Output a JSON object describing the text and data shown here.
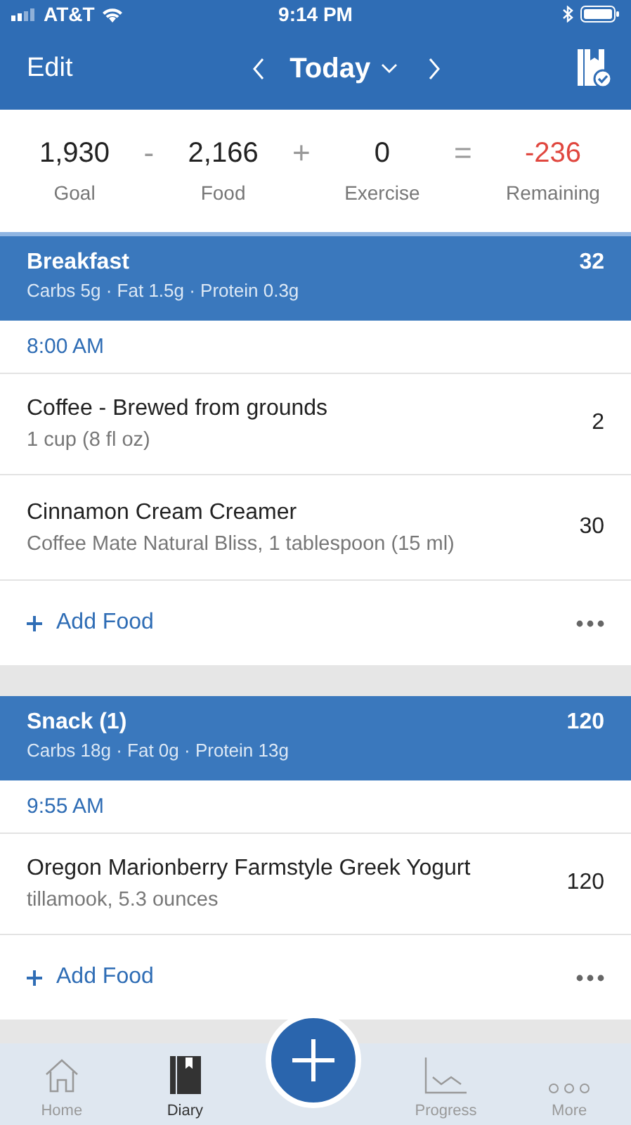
{
  "status_bar": {
    "carrier": "AT&T",
    "time": "9:14 PM"
  },
  "nav": {
    "edit": "Edit",
    "title": "Today"
  },
  "summary": {
    "operators": [
      "-",
      "+",
      "="
    ],
    "terms": [
      {
        "value": "1,930",
        "label": "Goal",
        "negative": false
      },
      {
        "value": "2,166",
        "label": "Food",
        "negative": false
      },
      {
        "value": "0",
        "label": "Exercise",
        "negative": false
      },
      {
        "value": "-236",
        "label": "Remaining",
        "negative": true
      }
    ]
  },
  "meals": [
    {
      "name": "Breakfast",
      "calories": "32",
      "macros": "Carbs 5g · Fat 1.5g · Protein 0.3g",
      "time": "8:00 AM",
      "add_label": "Add Food",
      "foods": [
        {
          "name": "Coffee - Brewed from grounds",
          "detail": "1 cup (8 fl oz)",
          "calories": "2"
        },
        {
          "name": "Cinnamon Cream Creamer",
          "detail": "Coffee Mate Natural Bliss, 1 tablespoon (15 ml)",
          "calories": "30"
        }
      ]
    },
    {
      "name": "Snack (1)",
      "calories": "120",
      "macros": "Carbs 18g · Fat 0g · Protein 13g",
      "time": "9:55 AM",
      "add_label": "Add Food",
      "foods": [
        {
          "name": "Oregon Marionberry Farmstyle Greek Yogurt",
          "detail": "tillamook, 5.3 ounces",
          "calories": "120"
        }
      ]
    }
  ],
  "tabs": [
    {
      "kind": "home",
      "label": "Home",
      "selected": false
    },
    {
      "kind": "diary",
      "label": "Diary",
      "selected": true
    },
    {
      "kind": "add",
      "selected": false
    },
    {
      "kind": "progress",
      "label": "Progress",
      "selected": false
    },
    {
      "kind": "more",
      "label": "More",
      "selected": false
    }
  ]
}
